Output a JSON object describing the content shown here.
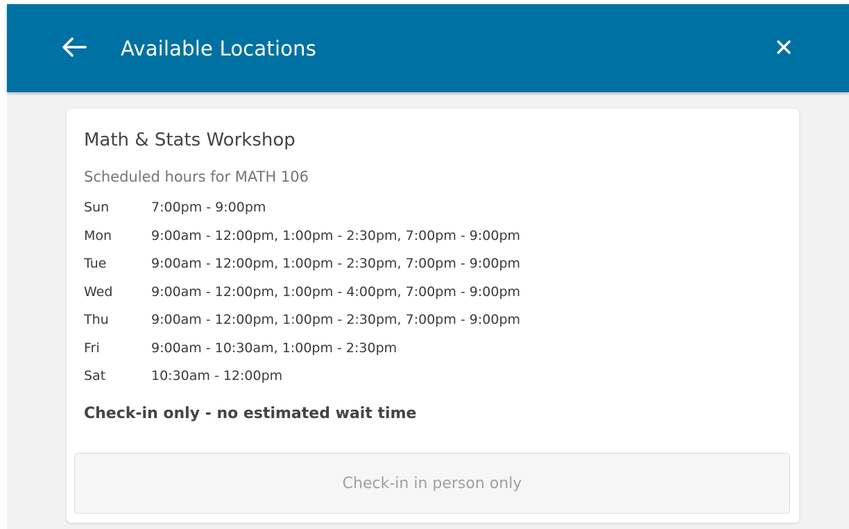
{
  "header": {
    "title": "Available Locations",
    "back_icon": "arrow-left-icon",
    "close_icon": "close-icon",
    "background_color": "#0071a3"
  },
  "location": {
    "name": "Math & Stats Workshop",
    "subtitle": "Scheduled hours for MATH 106",
    "hours": [
      {
        "day": "Sun",
        "time": "7:00pm - 9:00pm"
      },
      {
        "day": "Mon",
        "time": "9:00am - 12:00pm, 1:00pm - 2:30pm, 7:00pm - 9:00pm"
      },
      {
        "day": "Tue",
        "time": "9:00am - 12:00pm, 1:00pm - 2:30pm, 7:00pm - 9:00pm"
      },
      {
        "day": "Wed",
        "time": "9:00am - 12:00pm, 1:00pm - 4:00pm, 7:00pm - 9:00pm"
      },
      {
        "day": "Thu",
        "time": "9:00am - 12:00pm, 1:00pm - 2:30pm, 7:00pm - 9:00pm"
      },
      {
        "day": "Fri",
        "time": "9:00am - 10:30am, 1:00pm - 2:30pm"
      },
      {
        "day": "Sat",
        "time": "10:30am - 12:00pm"
      }
    ],
    "wait_status": "Check-in only - no estimated wait time",
    "checkin_button_label": "Check-in in person only"
  }
}
